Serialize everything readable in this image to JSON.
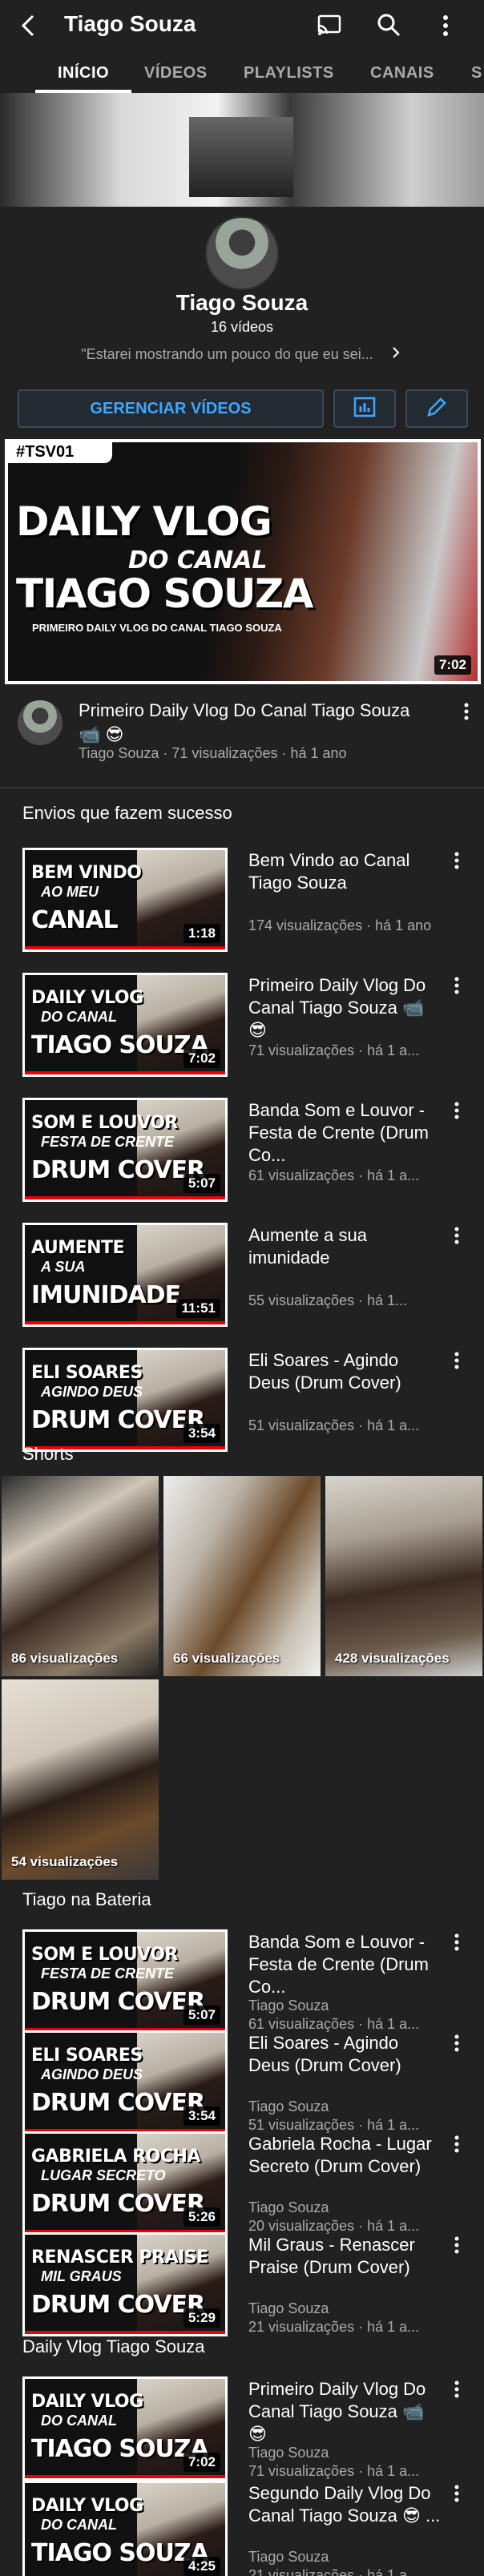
{
  "header": {
    "title": "Tiago Souza",
    "back_icon": "back-arrow-icon",
    "cast_icon": "cast-icon",
    "search_icon": "search-icon",
    "more_icon": "more-vert-icon"
  },
  "tabs": [
    {
      "label": "INÍCIO",
      "active": true
    },
    {
      "label": "VÍDEOS",
      "active": false
    },
    {
      "label": "PLAYLISTS",
      "active": false
    },
    {
      "label": "CANAIS",
      "active": false
    },
    {
      "label": "S",
      "active": false
    }
  ],
  "channel": {
    "name": "Tiago Souza",
    "video_count": "16 vídeos",
    "description": "\"Estarei mostrando um pouco do que eu sei...",
    "manage_button": "GERENCIAR VÍDEOS"
  },
  "featured": {
    "badge": "#TSV01",
    "line1": "DAILY VLOG",
    "line2": "DO CANAL",
    "line3": "TIAGO SOUZA",
    "caption": "PRIMEIRO DAILY VLOG DO CANAL TIAGO SOUZA",
    "duration": "7:02",
    "title": "Primeiro Daily Vlog Do Canal Tiago Souza 📹 😎",
    "meta": "Tiago Souza · 71 visualizações · há 1 ano"
  },
  "section_popular": {
    "title": "Envios que fazem sucesso",
    "videos": [
      {
        "thumb_l1": "BEM VINDO",
        "thumb_l2": "AO MEU",
        "thumb_l3": "CANAL",
        "duration": "1:18",
        "title": "Bem Vindo ao Canal Tiago Souza",
        "meta1": "174 visualizações · há 1 ano"
      },
      {
        "thumb_l1": "DAILY VLOG",
        "thumb_l2": "DO CANAL",
        "thumb_l3": "TIAGO SOUZA",
        "duration": "7:02",
        "title": "Primeiro Daily Vlog Do Canal Tiago Souza 📹 😎",
        "meta1": "71 visualizações · há 1 a..."
      },
      {
        "thumb_l1": "SOM E LOUVOR",
        "thumb_l2": "FESTA DE CRENTE",
        "thumb_l3": "DRUM COVER",
        "duration": "5:07",
        "title": "Banda Som e Louvor - Festa de Crente (Drum Co...",
        "meta1": "61 visualizações · há 1 a..."
      },
      {
        "thumb_l1": "AUMENTE",
        "thumb_l2": "A SUA",
        "thumb_l3": "IMUNIDADE",
        "duration": "11:51",
        "title": "Aumente a sua imunidade",
        "meta1": "55 visualizações · há 1..."
      },
      {
        "thumb_l1": "ELI SOARES",
        "thumb_l2": "AGINDO DEUS",
        "thumb_l3": "DRUM COVER",
        "duration": "3:54",
        "title": "Eli Soares - Agindo Deus (Drum Cover)",
        "meta1": "51 visualizações · há 1 a..."
      }
    ]
  },
  "section_shorts": {
    "title": "Shorts",
    "items": [
      {
        "views": "86 visualizações"
      },
      {
        "views": "66 visualizações"
      },
      {
        "views": "428 visualizações"
      },
      {
        "views": "54 visualizações"
      }
    ]
  },
  "section_bateria": {
    "title": "Tiago na Bateria",
    "videos": [
      {
        "thumb_l1": "SOM E LOUVOR",
        "thumb_l2": "FESTA DE CRENTE",
        "thumb_l3": "DRUM COVER",
        "duration": "5:07",
        "title": "Banda Som e Louvor - Festa de Crente (Drum Co...",
        "channel": "Tiago Souza",
        "meta1": "61 visualizações · há 1 a..."
      },
      {
        "thumb_l1": "ELI SOARES",
        "thumb_l2": "AGINDO DEUS",
        "thumb_l3": "DRUM COVER",
        "duration": "3:54",
        "title": "Eli Soares - Agindo Deus (Drum Cover)",
        "channel": "Tiago Souza",
        "meta1": "51 visualizações · há 1 a..."
      },
      {
        "thumb_l1": "GABRIELA ROCHA",
        "thumb_l2": "LUGAR SECRETO",
        "thumb_l3": "DRUM COVER",
        "duration": "5:26",
        "title": "Gabriela Rocha - Lugar Secreto (Drum Cover)",
        "channel": "Tiago Souza",
        "meta1": "20 visualizações · há 1 a..."
      },
      {
        "thumb_l1": "RENASCER PRAISE",
        "thumb_l2": "MIL GRAUS",
        "thumb_l3": "DRUM COVER",
        "duration": "5:29",
        "title": "Mil Graus - Renascer Praise (Drum Cover)",
        "channel": "Tiago Souza",
        "meta1": "21 visualizações · há 1 a..."
      }
    ]
  },
  "section_vlog": {
    "title": "Daily Vlog Tiago Souza",
    "videos": [
      {
        "thumb_l1": "DAILY VLOG",
        "thumb_l2": "DO CANAL",
        "thumb_l3": "TIAGO SOUZA",
        "duration": "7:02",
        "title": "Primeiro Daily Vlog Do Canal Tiago Souza 📹 😎",
        "channel": "Tiago Souza",
        "meta1": "71 visualizações · há 1 a..."
      },
      {
        "thumb_l1": "DAILY VLOG",
        "thumb_l2": "DO CANAL",
        "thumb_l3": "TIAGO SOUZA",
        "duration": "4:25",
        "title": "Segundo Daily Vlog Do Canal Tiago Souza 😎 ...",
        "channel": "Tiago Souza",
        "meta1": "21 visualizações · há 1 a..."
      }
    ]
  },
  "colors": {
    "background": "#212121",
    "accent": "#3ea6ff",
    "progress": "#ee0000"
  }
}
